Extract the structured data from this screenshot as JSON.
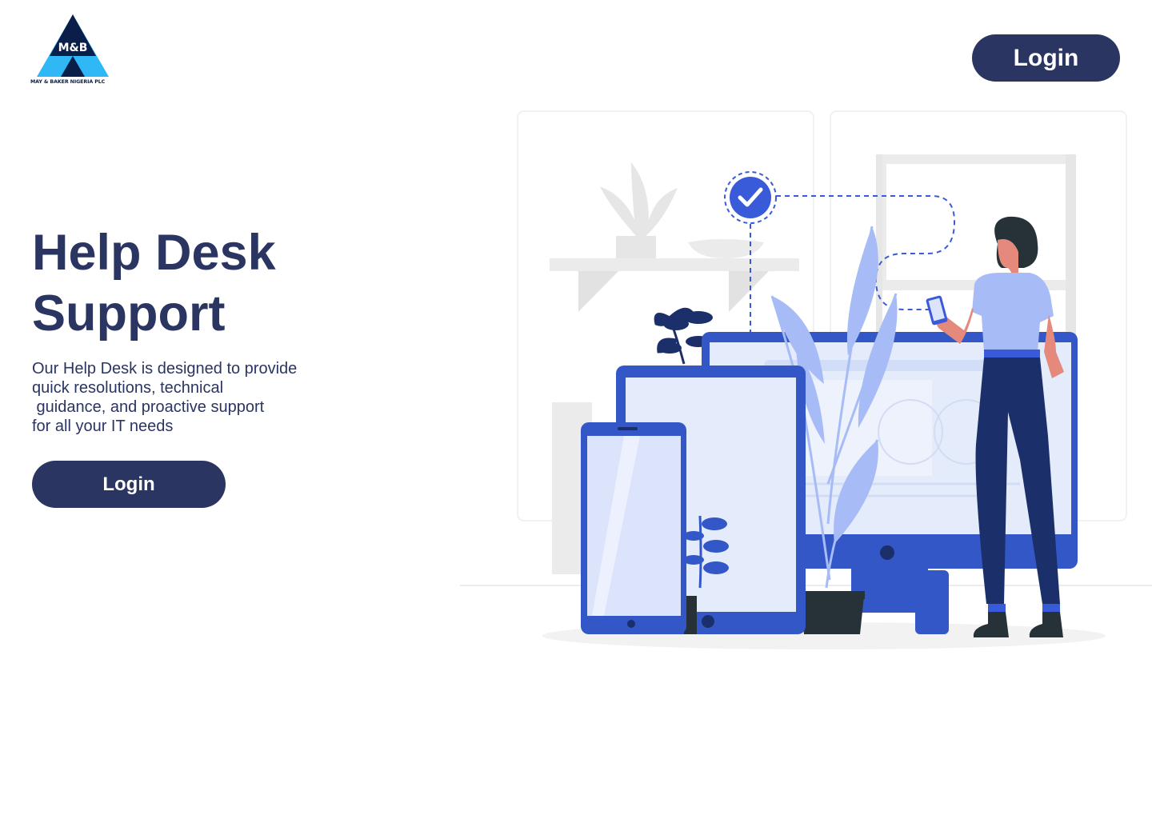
{
  "header": {
    "logo": {
      "brand": "M&B",
      "company": "MAY & BAKER NIGERIA PLC"
    },
    "login_label": "Login"
  },
  "hero": {
    "title_lines": [
      "Help Desk",
      "Support"
    ],
    "description_lines": [
      "Our Help Desk is designed to provide",
      "quick resolutions, technical",
      " guidance, and proactive support",
      "for all your IT needs"
    ],
    "login_label": "Login"
  },
  "illustration": {
    "subject": "help-desk-devices-illustration",
    "icons": [
      "check-icon"
    ]
  },
  "colors": {
    "primary": "#2b3561",
    "logo_navy": "#0a1e4a",
    "logo_cyan": "#2fb8f5",
    "accent_blue": "#3a5bd9",
    "device_blue": "#3457c7",
    "light_blue": "#a7bcf7",
    "screen_fill": "#e4ebfb"
  }
}
